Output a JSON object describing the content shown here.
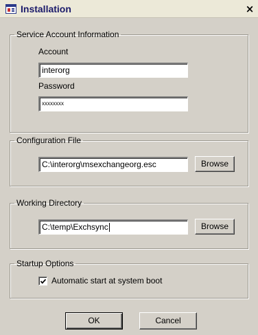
{
  "window": {
    "title": "Installation",
    "close_glyph": "×"
  },
  "service_account": {
    "legend": "Service Account Information",
    "account_label": "Account",
    "account_value": "interorg",
    "password_label": "Password",
    "password_value": "xxxxxxxx"
  },
  "config_file": {
    "legend": "Configuration File",
    "path_value": "C:\\interorg\\msexchangeorg.esc",
    "browse_label": "Browse"
  },
  "working_dir": {
    "legend": "Working Directory",
    "path_value": "C:\\temp\\Exchsync",
    "browse_label": "Browse"
  },
  "startup": {
    "legend": "Startup Options",
    "auto_start_label": "Automatic start at system boot",
    "auto_start_checked": true
  },
  "actions": {
    "ok_label": "OK",
    "cancel_label": "Cancel"
  },
  "icons": {
    "app": "window-app-icon",
    "close": "close-icon",
    "check": "check-icon"
  }
}
